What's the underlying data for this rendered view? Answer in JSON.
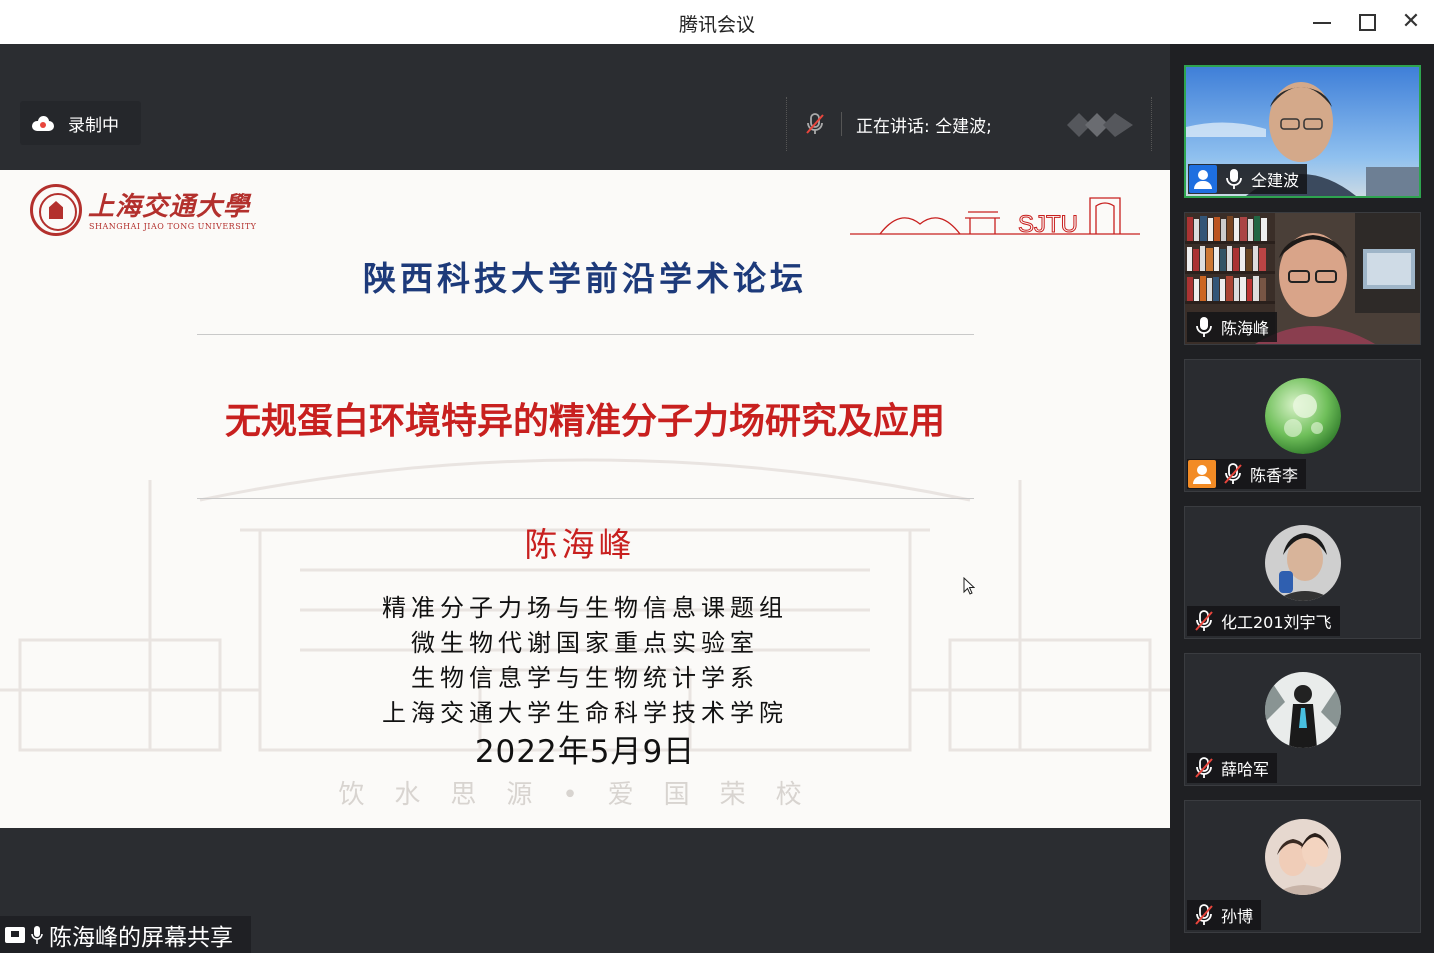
{
  "window": {
    "title": "腾讯会议"
  },
  "recording": {
    "label": "录制中"
  },
  "speaking": {
    "text": "正在讲话: 仝建波;"
  },
  "slide": {
    "university_cn": "上海交通大學",
    "university_en": "SHANGHAI JIAO TONG UNIVERSITY",
    "sjtu_mark": "SJTU",
    "forum": "陕西科技大学前沿学术论坛",
    "title": "无规蛋白环境特异的精准分子力场研究及应用",
    "author": "陈海峰",
    "affiliations": [
      "精准分子力场与生物信息课题组",
      "微生物代谢国家重点实验室",
      "生物信息学与生物统计学系",
      "上海交通大学生命科学技术学院"
    ],
    "date": "2022年5月9日",
    "motto": "饮水思源•爱国荣校"
  },
  "share": {
    "label": "陈海峰的屏幕共享"
  },
  "participants": [
    {
      "name": "仝建波",
      "mic": "on",
      "host": true
    },
    {
      "name": "陈海峰",
      "mic": "on",
      "host": false
    },
    {
      "name": "陈香李",
      "mic": "muted",
      "host": true
    },
    {
      "name": "化工201刘宇飞",
      "mic": "muted",
      "host": false
    },
    {
      "name": "薛哈军",
      "mic": "muted",
      "host": false
    },
    {
      "name": "孙博",
      "mic": "muted",
      "host": false
    }
  ]
}
